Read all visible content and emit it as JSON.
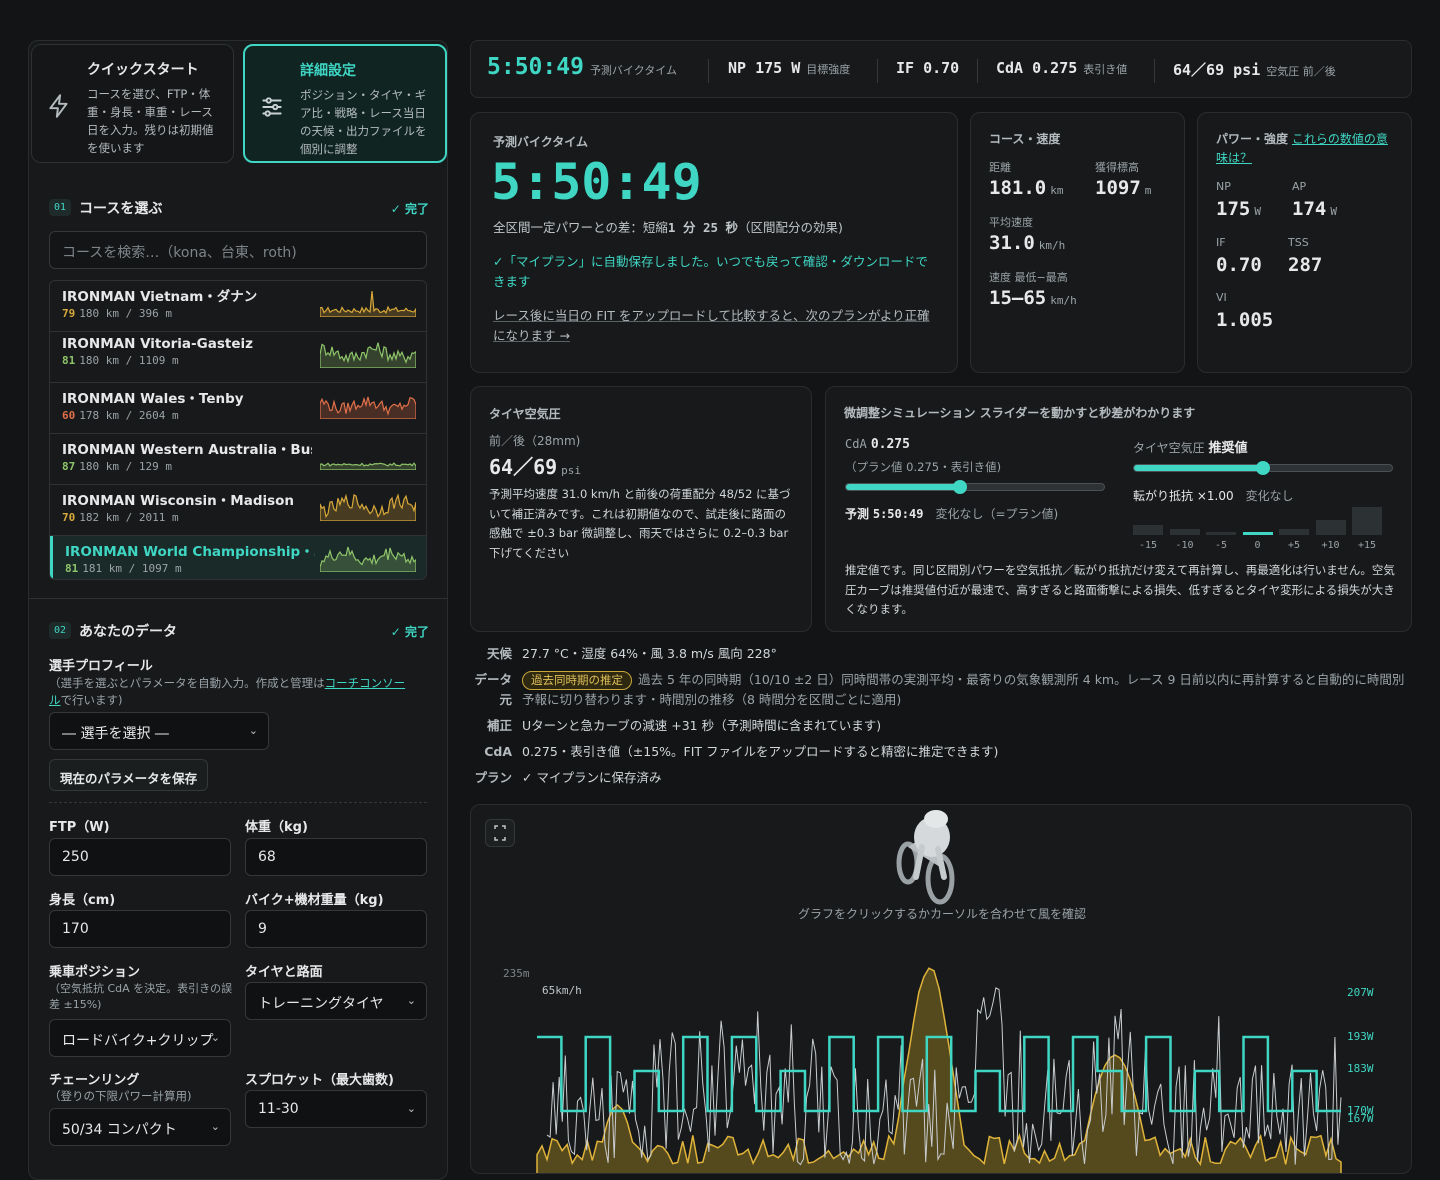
{
  "colors": {
    "accent": "#3fd6c4",
    "warn": "#e0c05a",
    "bg": "#121415"
  },
  "modes": {
    "quick": {
      "title": "クイックスタート",
      "desc": "コースを選び、FTP・体重・身長・車重・レース日を入力。残りは初期値を使います",
      "icon": "lightning-icon"
    },
    "detail": {
      "title": "詳細設定",
      "desc": "ポジション・タイヤ・ギア比・戦略・レース当日の天候・出力ファイルを個別に調整",
      "icon": "sliders-icon"
    }
  },
  "course_section": {
    "num": "01",
    "title": "コースを選ぶ",
    "done": "✓ 完了",
    "search_placeholder": "コースを検索…（kona、台東、roth)"
  },
  "courses": [
    {
      "name": "IRONMAN Vietnam・ダナン",
      "score": "79",
      "meta": "180 km / 396 m",
      "color": "#d8a93a"
    },
    {
      "name": "IRONMAN Vitoria-Gasteiz",
      "score": "81",
      "meta": "180 km / 1109 m",
      "color": "#8ec46a"
    },
    {
      "name": "IRONMAN Wales・Tenby",
      "score": "60",
      "meta": "178 km / 2604 m",
      "color": "#e0704a"
    },
    {
      "name": "IRONMAN Western Australia・Bus…",
      "score": "87",
      "meta": "180 km / 129 m",
      "color": "#8ec46a"
    },
    {
      "name": "IRONMAN Wisconsin・Madison",
      "score": "70",
      "meta": "182 km / 2011 m",
      "color": "#d8a93a"
    },
    {
      "name": "IRONMAN World Championship・…",
      "score": "81",
      "meta": "181 km / 1097 m",
      "color": "#8ec46a",
      "selected": true
    }
  ],
  "data_section": {
    "num": "02",
    "title": "あなたのデータ",
    "done": "✓ 完了",
    "profile_label": "選手プロフィール",
    "profile_sub1": "（選手を選ぶとパラメータを自動入力。作成と管理は",
    "profile_link1": "コーチコンソー",
    "profile_link2": "ル",
    "profile_sub2": "で行います)",
    "athlete_select": "― 選手を選択 ―",
    "save_button": "現在のパラメータを保存",
    "ftp_label": "FTP（W)",
    "ftp_value": "250",
    "weight_label": "体重（kg)",
    "weight_value": "68",
    "height_label": "身長（cm)",
    "height_value": "170",
    "bike_label": "バイク+機材重量（kg)",
    "bike_value": "9",
    "position_label": "乗車ポジション",
    "position_sub": "（空気抵抗 CdA を決定。表引きの誤差 ±15%)",
    "position_value": "ロードバイク+クリップ",
    "tire_label": "タイヤと路面",
    "tire_value": "トレーニングタイヤ",
    "chainring_label": "チェーンリング",
    "chainring_sub": "（登りの下限パワー計算用)",
    "chainring_value": "50/34 コンパクト",
    "sprocket_label": "スプロケット（最大歯数)",
    "sprocket_value": "11-30"
  },
  "topbar": {
    "time": "5:50:49",
    "time_label": "予測バイクタイム",
    "np": "NP 175 W",
    "np_label": "目標強度",
    "if": "IF 0.70",
    "cda": "CdA 0.275",
    "cda_label": "表引き値",
    "psi": "64／69 psi",
    "psi_label": "空気圧 前／後"
  },
  "prediction": {
    "title": "予測バイクタイム",
    "time": "5:50:49",
    "diff_text": "全区間一定パワーとの差：短縮",
    "diff_value": "1 分 25 秒",
    "diff_note": "（区間配分の効果)",
    "saved": "✓「マイプラン」に自動保存しました。いつでも戻って確認・ダウンロードできます",
    "fit_link": "レース後に当日の FIT をアップロードして比較すると、次のプランがより正確になります →"
  },
  "course_speed": {
    "title": "コース・速度",
    "dist_label": "距離",
    "dist_value": "181.0",
    "dist_unit": "km",
    "elev_label": "獲得標高",
    "elev_value": "1097",
    "elev_unit": "m",
    "avg_label": "平均速度",
    "avg_value": "31.0",
    "avg_unit": "km/h",
    "range_label": "速度 最低−最高",
    "range_value": "15–65",
    "range_unit": "km/h"
  },
  "power": {
    "title": "パワー・強度",
    "link": "これらの数値の意味は？",
    "np_label": "NP",
    "np_value": "175",
    "np_unit": "W",
    "ap_label": "AP",
    "ap_value": "174",
    "ap_unit": "W",
    "if_label": "IF",
    "if_value": "0.70",
    "tss_label": "TSS",
    "tss_value": "287",
    "vi_label": "VI",
    "vi_value": "1.005"
  },
  "tire": {
    "title": "タイヤ空気圧",
    "sub": "前／後（28mm)",
    "value": "64／69",
    "unit": "psi",
    "desc": "予測平均速度 31.0 km/h と前後の荷重配分 48/52 に基づいて補正済みです。これは初期値なので、試走後に路面の感触で ±0.3 bar 微調整し、雨天ではさらに 0.2–0.3 bar 下げてください"
  },
  "sim": {
    "title": "微調整シミュレーション スライダーを動かすと秒差がわかります",
    "cda_label": "CdA",
    "cda_value": "0.275",
    "cda_sub": "（プラン値 0.275・表引き値)",
    "cda_level": 0.44,
    "pred_label": "予測",
    "pred_value": "5:50:49",
    "pred_note": "変化なし（=プラン値)",
    "psi_label": "タイヤ空気圧",
    "psi_value": "推奨値",
    "psi_level": 0.5,
    "rr_label": "転がり抵抗 ×1.00",
    "rr_note": "変化なし",
    "bars_x": [
      "-15",
      "-10",
      "-5",
      "0",
      "+5",
      "+10",
      "+15"
    ],
    "bars_level": [
      0.35,
      0.2,
      0.1,
      0.12,
      0.22,
      0.55,
      1.0
    ],
    "note": "推定値です。同じ区間別パワーを空気抵抗／転がり抵抗だけ変えて再計算し、再最適化は行いません。空気圧カーブは推奨値付近が最速で、高すぎると路面衝撃による損失、低すぎるとタイヤ変形による損失が大きくなります。"
  },
  "info": {
    "weather_k": "天候",
    "weather_v": "27.7 °C・湿度 64%・風 3.8 m/s 風向 228°",
    "data_k": "データ元",
    "data_pill": "過去同時期の推定",
    "data_v": "過去 5 年の同時期（10/10 ±2 日）同時間帯の実測平均・最寄りの気象観測所 4 km。レース 9 日前以内に再計算すると自動的に時間別予報に切り替わります・時間別の推移（8 時間分を区間ごとに適用)",
    "corr_k": "補正",
    "corr_v": "Uターンと急カーブの減速 +31 秒（予測時間に含まれています)",
    "cda_k": "CdA",
    "cda_v": "0.275・表引き値（±15%。FIT ファイルをアップロードすると精密に推定できます)",
    "plan_k": "プラン",
    "plan_v": "✓ マイプランに保存済み"
  },
  "chart": {
    "hint": "グラフをクリックするかカーソルを合わせて風を確認",
    "elev_top": "235m",
    "speed_top": "65km/h",
    "power_ticks": [
      "207W",
      "193W",
      "183W",
      "170W",
      "167W"
    ]
  }
}
